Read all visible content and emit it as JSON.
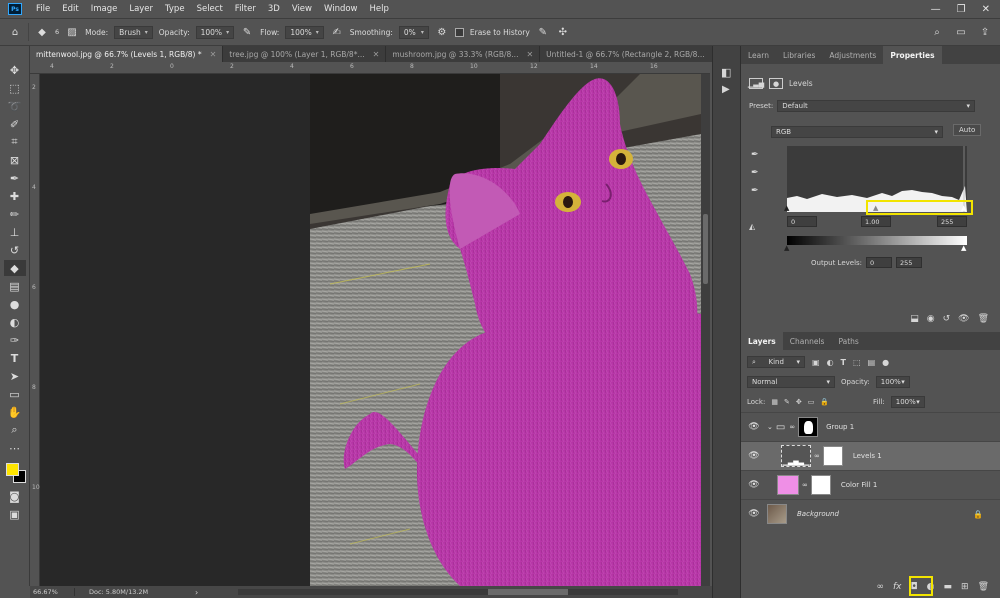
{
  "menubar": {
    "logo": "Ps",
    "items": [
      "File",
      "Edit",
      "Image",
      "Layer",
      "Type",
      "Select",
      "Filter",
      "3D",
      "View",
      "Window",
      "Help"
    ],
    "window_controls": [
      "—",
      "❐",
      "✕"
    ]
  },
  "options": {
    "brush_size": "6",
    "mode_label": "Mode:",
    "mode_value": "Brush",
    "opacity_label": "Opacity:",
    "opacity_value": "100%",
    "flow_label": "Flow:",
    "flow_value": "100%",
    "smoothing_label": "Smoothing:",
    "smoothing_value": "0%",
    "erase_history_label": "Erase to History"
  },
  "tabs": [
    {
      "label": "mittenwool.jpg @ 66.7% (Levels 1, RGB/8) *",
      "active": true
    },
    {
      "label": "tree.jpg @ 100% (Layer 1, RGB/8*...",
      "active": false
    },
    {
      "label": "mushroom.jpg @ 33.3% (RGB/8...",
      "active": false
    },
    {
      "label": "Untitled-1 @ 66.7% (Rectangle 2, RGB/8...",
      "active": false
    }
  ],
  "ruler": {
    "top": [
      "4",
      "2",
      "0",
      "2",
      "4",
      "6",
      "8",
      "10",
      "12",
      "14",
      "16"
    ],
    "left": [
      "2",
      "4",
      "6",
      "8",
      "10"
    ]
  },
  "statusbar": {
    "zoom": "66.67%",
    "doc": "Doc: 5.80M/13.2M"
  },
  "properties_panel": {
    "tabs": [
      "Learn",
      "Libraries",
      "Adjustments",
      "Properties"
    ],
    "active_tab": "Properties",
    "adjustment_name": "Levels",
    "preset_label": "Preset:",
    "preset_value": "Default",
    "channel_value": "RGB",
    "auto_label": "Auto",
    "input_black": "0",
    "input_gamma": "1.00",
    "input_white": "255",
    "output_label": "Output Levels:",
    "output_black": "0",
    "output_white": "255"
  },
  "layers_panel": {
    "tabs": [
      "Layers",
      "Channels",
      "Paths"
    ],
    "active_tab": "Layers",
    "kind_label": "Kind",
    "blend_mode": "Normal",
    "opacity_label": "Opacity:",
    "opacity_value": "100%",
    "lock_label": "Lock:",
    "fill_label": "Fill:",
    "fill_value": "100%",
    "layers": [
      {
        "name": "Group 1",
        "type": "group",
        "selected": false
      },
      {
        "name": "Levels 1",
        "type": "adjustment",
        "selected": true
      },
      {
        "name": "Color Fill 1",
        "type": "fill",
        "fill_color": "#ef8fe6",
        "selected": false
      },
      {
        "name": "Background",
        "type": "image",
        "selected": false,
        "locked": true
      }
    ]
  },
  "colors": {
    "foreground": "#ffe500",
    "background": "#000000",
    "highlight": "#f2e400",
    "cat_magenta": "#b836a8"
  }
}
